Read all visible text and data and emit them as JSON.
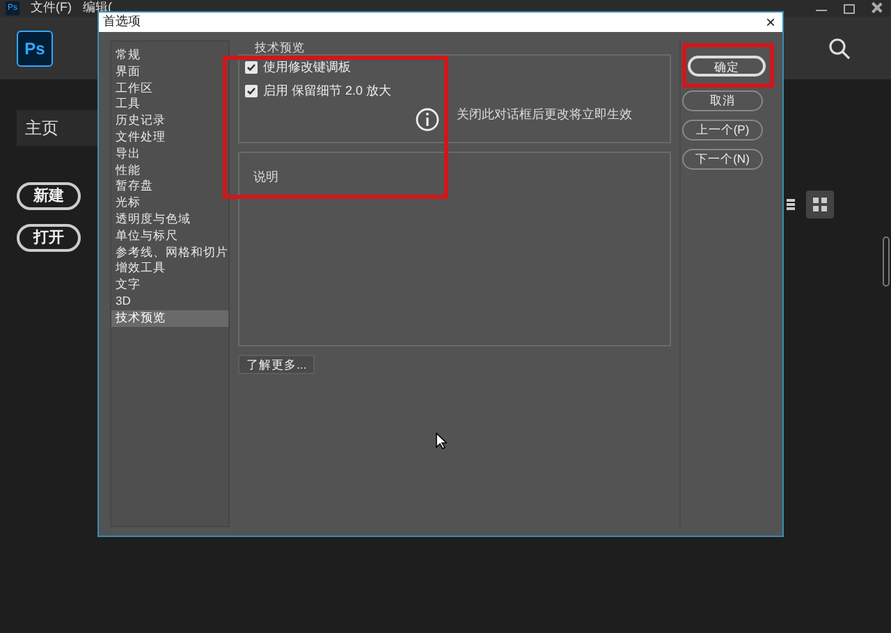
{
  "app": {
    "menu_logo": "Ps",
    "logo": "Ps",
    "menu": [
      "文件(F)",
      "编辑("
    ],
    "home": "主页",
    "buttons": [
      "新建",
      "打开"
    ]
  },
  "dialog": {
    "title": "首选项",
    "close": "×",
    "categories": [
      {
        "label": "常规",
        "selected": false
      },
      {
        "label": "界面",
        "selected": false
      },
      {
        "label": "工作区",
        "selected": false
      },
      {
        "label": "工具",
        "selected": false
      },
      {
        "label": "历史记录",
        "selected": false
      },
      {
        "label": "文件处理",
        "selected": false
      },
      {
        "label": "导出",
        "selected": false
      },
      {
        "label": "性能",
        "selected": false
      },
      {
        "label": "暂存盘",
        "selected": false
      },
      {
        "label": "光标",
        "selected": false
      },
      {
        "label": "透明度与色域",
        "selected": false
      },
      {
        "label": "单位与标尺",
        "selected": false
      },
      {
        "label": "参考线、网格和切片",
        "selected": false
      },
      {
        "label": "增效工具",
        "selected": false
      },
      {
        "label": "文字",
        "selected": false
      },
      {
        "label": "3D",
        "selected": false
      },
      {
        "label": "技术预览",
        "selected": true
      }
    ],
    "group_title": "技术预览",
    "options": [
      {
        "label": "使用修改键调板",
        "checked": true
      },
      {
        "label": "启用 保留细节 2.0 放大",
        "checked": true
      }
    ],
    "info": "关闭此对话框后更改将立即生效",
    "description_title": "说明",
    "learn_more": "了解更多...",
    "actions": [
      {
        "label": "确定",
        "selected": true
      },
      {
        "label": "取消",
        "selected": false
      },
      {
        "label": "上一个(P)",
        "selected": false
      },
      {
        "label": "下一个(N)",
        "selected": false
      }
    ]
  }
}
